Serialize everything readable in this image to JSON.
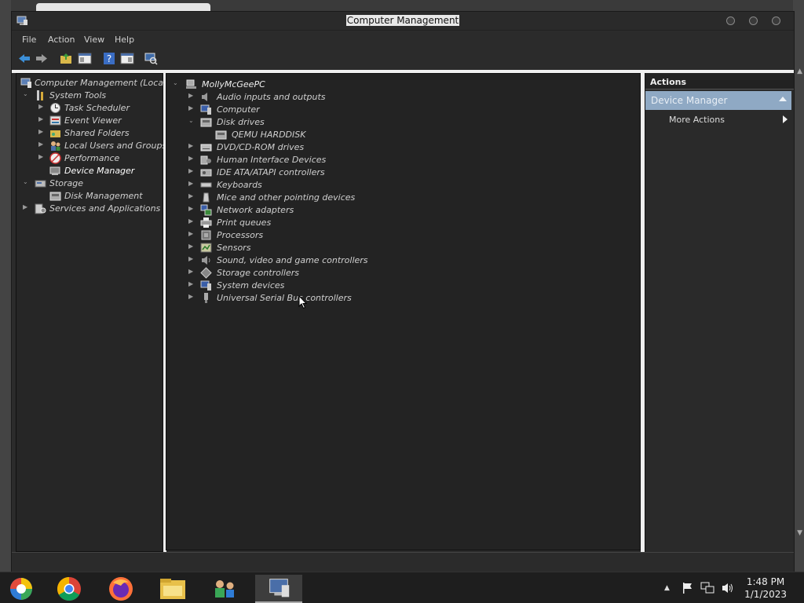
{
  "window": {
    "title": "Computer Management"
  },
  "menu": [
    "File",
    "Action",
    "View",
    "Help"
  ],
  "left_tree": [
    {
      "label": "Computer Management (Local)",
      "icon": "computer-management-icon",
      "level": 0,
      "expander": ""
    },
    {
      "label": "System Tools",
      "icon": "tools-icon",
      "level": 1,
      "expander": "v"
    },
    {
      "label": "Task Scheduler",
      "icon": "clock-icon",
      "level": 2,
      "expander": ">"
    },
    {
      "label": "Event Viewer",
      "icon": "event-viewer-icon",
      "level": 2,
      "expander": ">"
    },
    {
      "label": "Shared Folders",
      "icon": "shared-folder-icon",
      "level": 2,
      "expander": ">"
    },
    {
      "label": "Local Users and Groups",
      "icon": "users-icon",
      "level": 2,
      "expander": ">"
    },
    {
      "label": "Performance",
      "icon": "performance-icon",
      "level": 2,
      "expander": ">"
    },
    {
      "label": "Device Manager",
      "icon": "device-manager-icon",
      "level": 2,
      "expander": "",
      "selected": true
    },
    {
      "label": "Storage",
      "icon": "storage-icon",
      "level": 1,
      "expander": "v"
    },
    {
      "label": "Disk Management",
      "icon": "disk-icon",
      "level": 2,
      "expander": ""
    },
    {
      "label": "Services and Applications",
      "icon": "services-icon",
      "level": 1,
      "expander": ">"
    }
  ],
  "device_tree": [
    {
      "label": "MollyMcGeePC",
      "icon": "computer-icon",
      "level": 0,
      "expander": "v"
    },
    {
      "label": "Audio inputs and outputs",
      "icon": "speaker-icon",
      "level": 1,
      "expander": ">"
    },
    {
      "label": "Computer",
      "icon": "monitor-icon",
      "level": 1,
      "expander": ">"
    },
    {
      "label": "Disk drives",
      "icon": "disk-drive-icon",
      "level": 1,
      "expander": "v"
    },
    {
      "label": "QEMU HARDDISK",
      "icon": "harddisk-icon",
      "level": 2,
      "expander": ""
    },
    {
      "label": "DVD/CD-ROM drives",
      "icon": "dvd-icon",
      "level": 1,
      "expander": ">"
    },
    {
      "label": "Human Interface Devices",
      "icon": "hid-icon",
      "level": 1,
      "expander": ">"
    },
    {
      "label": "IDE ATA/ATAPI controllers",
      "icon": "ide-icon",
      "level": 1,
      "expander": ">"
    },
    {
      "label": "Keyboards",
      "icon": "keyboard-icon",
      "level": 1,
      "expander": ">"
    },
    {
      "label": "Mice and other pointing devices",
      "icon": "mouse-icon",
      "level": 1,
      "expander": ">"
    },
    {
      "label": "Network adapters",
      "icon": "network-icon",
      "level": 1,
      "expander": ">"
    },
    {
      "label": "Print queues",
      "icon": "printer-icon",
      "level": 1,
      "expander": ">"
    },
    {
      "label": "Processors",
      "icon": "processor-icon",
      "level": 1,
      "expander": ">"
    },
    {
      "label": "Sensors",
      "icon": "sensor-icon",
      "level": 1,
      "expander": ">"
    },
    {
      "label": "Sound, video and game controllers",
      "icon": "sound-icon",
      "level": 1,
      "expander": ">"
    },
    {
      "label": "Storage controllers",
      "icon": "storage-controller-icon",
      "level": 1,
      "expander": ">"
    },
    {
      "label": "System devices",
      "icon": "system-device-icon",
      "level": 1,
      "expander": ">"
    },
    {
      "label": "Universal Serial Bus controllers",
      "icon": "usb-icon",
      "level": 1,
      "expander": ">"
    }
  ],
  "actions": {
    "header": "Actions",
    "section": "Device Manager",
    "more": "More Actions"
  },
  "taskbar": {
    "apps": [
      "start-icon",
      "chrome-icon",
      "firefox-icon",
      "file-explorer-icon",
      "network-people-icon",
      "computer-management-task-icon"
    ],
    "time": "1:48 PM",
    "date": "1/1/2023"
  },
  "colors": {
    "selection": "#8fa9c4",
    "pane_bg": "#232323"
  }
}
